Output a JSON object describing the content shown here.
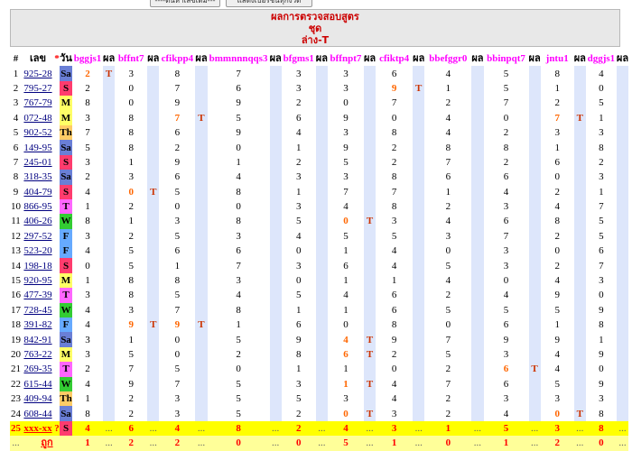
{
  "top_buttons": [
    "----ดันหาเลขเดิม----",
    "แสดงเบอร์ชนทุกงวด"
  ],
  "banner": {
    "line1": "ผลการตรวจสอบสูตร",
    "line2": "ชุด",
    "line3": "ล่าง-T"
  },
  "headers": {
    "num": "#",
    "lek": "เลข",
    "star": "*",
    "wan": "วัน",
    "pon": "ผล",
    "formulas": [
      "bggjs1",
      "bffnt7",
      "cfikpp4",
      "bmmnnnqqs3",
      "bfgms1",
      "bffnpt7",
      "cfiktp4",
      "bbefggr0",
      "bbinpqt7",
      "jntu1",
      "dggjs1"
    ]
  },
  "rows": [
    {
      "i": "1",
      "num": "925-28",
      "day": "Sa",
      "v": [
        {
          "x": "2",
          "h": 1
        },
        {
          "x": "3"
        },
        {
          "x": "8"
        },
        {
          "x": "7"
        },
        {
          "x": "3"
        },
        {
          "x": "3"
        },
        {
          "x": "6"
        },
        {
          "x": "4"
        },
        {
          "x": "5"
        },
        {
          "x": "8"
        },
        {
          "x": "4"
        }
      ],
      "p": [
        "T",
        "",
        "",
        "",
        "",
        "",
        "",
        "",
        "",
        "",
        ""
      ]
    },
    {
      "i": "2",
      "num": "795-27",
      "day": "S",
      "v": [
        {
          "x": "2"
        },
        {
          "x": "0"
        },
        {
          "x": "7"
        },
        {
          "x": "6"
        },
        {
          "x": "3"
        },
        {
          "x": "3"
        },
        {
          "x": "9",
          "h": 1
        },
        {
          "x": "1"
        },
        {
          "x": "5"
        },
        {
          "x": "1"
        },
        {
          "x": "0"
        }
      ],
      "p": [
        "",
        "",
        "",
        "",
        "",
        "",
        "T",
        "",
        "",
        "",
        ""
      ]
    },
    {
      "i": "3",
      "num": "767-79",
      "day": "M",
      "v": [
        {
          "x": "8"
        },
        {
          "x": "0"
        },
        {
          "x": "9"
        },
        {
          "x": "9"
        },
        {
          "x": "2"
        },
        {
          "x": "0"
        },
        {
          "x": "7"
        },
        {
          "x": "2"
        },
        {
          "x": "7"
        },
        {
          "x": "2"
        },
        {
          "x": "5"
        }
      ],
      "p": [
        "",
        "",
        "",
        "",
        "",
        "",
        "",
        "",
        "",
        "",
        ""
      ]
    },
    {
      "i": "4",
      "num": "072-48",
      "day": "M",
      "v": [
        {
          "x": "3"
        },
        {
          "x": "8"
        },
        {
          "x": "7",
          "h": 1
        },
        {
          "x": "5"
        },
        {
          "x": "6"
        },
        {
          "x": "9"
        },
        {
          "x": "0"
        },
        {
          "x": "4"
        },
        {
          "x": "0"
        },
        {
          "x": "7",
          "h": 1
        },
        {
          "x": "1"
        }
      ],
      "p": [
        "",
        "",
        "T",
        "",
        "",
        "",
        "",
        "",
        "",
        "T",
        ""
      ]
    },
    {
      "i": "5",
      "num": "902-52",
      "day": "Th",
      "v": [
        {
          "x": "7"
        },
        {
          "x": "8"
        },
        {
          "x": "6"
        },
        {
          "x": "9"
        },
        {
          "x": "4"
        },
        {
          "x": "3"
        },
        {
          "x": "8"
        },
        {
          "x": "4"
        },
        {
          "x": "2"
        },
        {
          "x": "3"
        },
        {
          "x": "3"
        }
      ],
      "p": [
        "",
        "",
        "",
        "",
        "",
        "",
        "",
        "",
        "",
        "",
        ""
      ]
    },
    {
      "i": "6",
      "num": "149-95",
      "day": "Sa",
      "v": [
        {
          "x": "5"
        },
        {
          "x": "8"
        },
        {
          "x": "2"
        },
        {
          "x": "0"
        },
        {
          "x": "1"
        },
        {
          "x": "9"
        },
        {
          "x": "2"
        },
        {
          "x": "8"
        },
        {
          "x": "8"
        },
        {
          "x": "1"
        },
        {
          "x": "8"
        }
      ],
      "p": [
        "",
        "",
        "",
        "",
        "",
        "",
        "",
        "",
        "",
        "",
        ""
      ]
    },
    {
      "i": "7",
      "num": "245-01",
      "day": "S",
      "v": [
        {
          "x": "3"
        },
        {
          "x": "1"
        },
        {
          "x": "9"
        },
        {
          "x": "1"
        },
        {
          "x": "2"
        },
        {
          "x": "5"
        },
        {
          "x": "2"
        },
        {
          "x": "7"
        },
        {
          "x": "2"
        },
        {
          "x": "6"
        },
        {
          "x": "2"
        }
      ],
      "p": [
        "",
        "",
        "",
        "",
        "",
        "",
        "",
        "",
        "",
        "",
        ""
      ]
    },
    {
      "i": "8",
      "num": "318-35",
      "day": "Sa",
      "v": [
        {
          "x": "2"
        },
        {
          "x": "3"
        },
        {
          "x": "6"
        },
        {
          "x": "4"
        },
        {
          "x": "3"
        },
        {
          "x": "3"
        },
        {
          "x": "8"
        },
        {
          "x": "6"
        },
        {
          "x": "6"
        },
        {
          "x": "0"
        },
        {
          "x": "3"
        }
      ],
      "p": [
        "",
        "",
        "",
        "",
        "",
        "",
        "",
        "",
        "",
        "",
        ""
      ]
    },
    {
      "i": "9",
      "num": "404-79",
      "day": "S",
      "v": [
        {
          "x": "4"
        },
        {
          "x": "0",
          "h": 1
        },
        {
          "x": "5"
        },
        {
          "x": "8"
        },
        {
          "x": "1"
        },
        {
          "x": "7"
        },
        {
          "x": "7"
        },
        {
          "x": "1"
        },
        {
          "x": "4"
        },
        {
          "x": "2"
        },
        {
          "x": "1"
        }
      ],
      "p": [
        "",
        "T",
        "",
        "",
        "",
        "",
        "",
        "",
        "",
        "",
        ""
      ]
    },
    {
      "i": "10",
      "num": "866-95",
      "day": "T",
      "v": [
        {
          "x": "1"
        },
        {
          "x": "2"
        },
        {
          "x": "0"
        },
        {
          "x": "0"
        },
        {
          "x": "3"
        },
        {
          "x": "4"
        },
        {
          "x": "8"
        },
        {
          "x": "2"
        },
        {
          "x": "3"
        },
        {
          "x": "4"
        },
        {
          "x": "7"
        }
      ],
      "p": [
        "",
        "",
        "",
        "",
        "",
        "",
        "",
        "",
        "",
        "",
        ""
      ]
    },
    {
      "i": "11",
      "num": "406-26",
      "day": "W",
      "v": [
        {
          "x": "8"
        },
        {
          "x": "1"
        },
        {
          "x": "3"
        },
        {
          "x": "8"
        },
        {
          "x": "5"
        },
        {
          "x": "0",
          "h": 1
        },
        {
          "x": "3"
        },
        {
          "x": "4"
        },
        {
          "x": "6"
        },
        {
          "x": "8"
        },
        {
          "x": "5"
        }
      ],
      "p": [
        "",
        "",
        "",
        "",
        "",
        "T",
        "",
        "",
        "",
        "",
        ""
      ]
    },
    {
      "i": "12",
      "num": "297-52",
      "day": "F",
      "v": [
        {
          "x": "3"
        },
        {
          "x": "2"
        },
        {
          "x": "5"
        },
        {
          "x": "3"
        },
        {
          "x": "4"
        },
        {
          "x": "5"
        },
        {
          "x": "5"
        },
        {
          "x": "3"
        },
        {
          "x": "7"
        },
        {
          "x": "2"
        },
        {
          "x": "5"
        }
      ],
      "p": [
        "",
        "",
        "",
        "",
        "",
        "",
        "",
        "",
        "",
        "",
        ""
      ]
    },
    {
      "i": "13",
      "num": "523-20",
      "day": "F",
      "v": [
        {
          "x": "4"
        },
        {
          "x": "5"
        },
        {
          "x": "6"
        },
        {
          "x": "6"
        },
        {
          "x": "0"
        },
        {
          "x": "1"
        },
        {
          "x": "4"
        },
        {
          "x": "0"
        },
        {
          "x": "3"
        },
        {
          "x": "0"
        },
        {
          "x": "6"
        }
      ],
      "p": [
        "",
        "",
        "",
        "",
        "",
        "",
        "",
        "",
        "",
        "",
        ""
      ]
    },
    {
      "i": "14",
      "num": "198-18",
      "day": "S",
      "v": [
        {
          "x": "0"
        },
        {
          "x": "5"
        },
        {
          "x": "1"
        },
        {
          "x": "7"
        },
        {
          "x": "3"
        },
        {
          "x": "6"
        },
        {
          "x": "4"
        },
        {
          "x": "5"
        },
        {
          "x": "3"
        },
        {
          "x": "2"
        },
        {
          "x": "7"
        }
      ],
      "p": [
        "",
        "",
        "",
        "",
        "",
        "",
        "",
        "",
        "",
        "",
        ""
      ]
    },
    {
      "i": "15",
      "num": "920-95",
      "day": "M",
      "v": [
        {
          "x": "1"
        },
        {
          "x": "8"
        },
        {
          "x": "8"
        },
        {
          "x": "3"
        },
        {
          "x": "0"
        },
        {
          "x": "1"
        },
        {
          "x": "1"
        },
        {
          "x": "4"
        },
        {
          "x": "0"
        },
        {
          "x": "4"
        },
        {
          "x": "3"
        }
      ],
      "p": [
        "",
        "",
        "",
        "",
        "",
        "",
        "",
        "",
        "",
        "",
        ""
      ]
    },
    {
      "i": "16",
      "num": "477-39",
      "day": "T",
      "v": [
        {
          "x": "3"
        },
        {
          "x": "8"
        },
        {
          "x": "5"
        },
        {
          "x": "4"
        },
        {
          "x": "5"
        },
        {
          "x": "4"
        },
        {
          "x": "6"
        },
        {
          "x": "2"
        },
        {
          "x": "4"
        },
        {
          "x": "9"
        },
        {
          "x": "0"
        }
      ],
      "p": [
        "",
        "",
        "",
        "",
        "",
        "",
        "",
        "",
        "",
        "",
        ""
      ]
    },
    {
      "i": "17",
      "num": "728-45",
      "day": "W",
      "v": [
        {
          "x": "4"
        },
        {
          "x": "3"
        },
        {
          "x": "7"
        },
        {
          "x": "8"
        },
        {
          "x": "1"
        },
        {
          "x": "1"
        },
        {
          "x": "6"
        },
        {
          "x": "5"
        },
        {
          "x": "5"
        },
        {
          "x": "5"
        },
        {
          "x": "9"
        }
      ],
      "p": [
        "",
        "",
        "",
        "",
        "",
        "",
        "",
        "",
        "",
        "",
        ""
      ]
    },
    {
      "i": "18",
      "num": "391-82",
      "day": "F",
      "v": [
        {
          "x": "4"
        },
        {
          "x": "9",
          "h": 1
        },
        {
          "x": "9",
          "h": 1
        },
        {
          "x": "1"
        },
        {
          "x": "6"
        },
        {
          "x": "0"
        },
        {
          "x": "8"
        },
        {
          "x": "0"
        },
        {
          "x": "6"
        },
        {
          "x": "1"
        },
        {
          "x": "8"
        }
      ],
      "p": [
        "",
        "T",
        "T",
        "",
        "",
        "",
        "",
        "",
        "",
        "",
        ""
      ]
    },
    {
      "i": "19",
      "num": "842-91",
      "day": "Sa",
      "v": [
        {
          "x": "3"
        },
        {
          "x": "1"
        },
        {
          "x": "0"
        },
        {
          "x": "5"
        },
        {
          "x": "9"
        },
        {
          "x": "4",
          "h": 1
        },
        {
          "x": "9"
        },
        {
          "x": "7"
        },
        {
          "x": "9"
        },
        {
          "x": "9"
        },
        {
          "x": "1"
        }
      ],
      "p": [
        "",
        "",
        "",
        "",
        "",
        "T",
        "",
        "",
        "",
        "",
        ""
      ]
    },
    {
      "i": "20",
      "num": "763-22",
      "day": "M",
      "v": [
        {
          "x": "3"
        },
        {
          "x": "5"
        },
        {
          "x": "0"
        },
        {
          "x": "2"
        },
        {
          "x": "8"
        },
        {
          "x": "6",
          "h": 1
        },
        {
          "x": "2"
        },
        {
          "x": "5"
        },
        {
          "x": "3"
        },
        {
          "x": "4"
        },
        {
          "x": "9"
        }
      ],
      "p": [
        "",
        "",
        "",
        "",
        "",
        "T",
        "",
        "",
        "",
        "",
        ""
      ]
    },
    {
      "i": "21",
      "num": "269-35",
      "day": "T",
      "v": [
        {
          "x": "2"
        },
        {
          "x": "7"
        },
        {
          "x": "5"
        },
        {
          "x": "0"
        },
        {
          "x": "1"
        },
        {
          "x": "1"
        },
        {
          "x": "0"
        },
        {
          "x": "2"
        },
        {
          "x": "6",
          "h": 1
        },
        {
          "x": "4"
        },
        {
          "x": "0"
        }
      ],
      "p": [
        "",
        "",
        "",
        "",
        "",
        "",
        "",
        "",
        "T",
        "",
        ""
      ]
    },
    {
      "i": "22",
      "num": "615-44",
      "day": "W",
      "v": [
        {
          "x": "4"
        },
        {
          "x": "9"
        },
        {
          "x": "7"
        },
        {
          "x": "5"
        },
        {
          "x": "3"
        },
        {
          "x": "1",
          "h": 1
        },
        {
          "x": "4"
        },
        {
          "x": "7"
        },
        {
          "x": "6"
        },
        {
          "x": "5"
        },
        {
          "x": "9"
        }
      ],
      "p": [
        "",
        "",
        "",
        "",
        "",
        "T",
        "",
        "",
        "",
        "",
        ""
      ]
    },
    {
      "i": "23",
      "num": "409-94",
      "day": "Th",
      "v": [
        {
          "x": "1"
        },
        {
          "x": "2"
        },
        {
          "x": "3"
        },
        {
          "x": "5"
        },
        {
          "x": "5"
        },
        {
          "x": "3"
        },
        {
          "x": "4"
        },
        {
          "x": "2"
        },
        {
          "x": "3"
        },
        {
          "x": "3"
        },
        {
          "x": "3"
        }
      ],
      "p": [
        "",
        "",
        "",
        "",
        "",
        "",
        "",
        "",
        "",
        "",
        ""
      ]
    },
    {
      "i": "24",
      "num": "608-44",
      "day": "Sa",
      "v": [
        {
          "x": "8"
        },
        {
          "x": "2"
        },
        {
          "x": "3"
        },
        {
          "x": "5"
        },
        {
          "x": "2"
        },
        {
          "x": "0",
          "h": 1
        },
        {
          "x": "3"
        },
        {
          "x": "2"
        },
        {
          "x": "4"
        },
        {
          "x": "0",
          "h": 1
        },
        {
          "x": "8"
        }
      ],
      "p": [
        "",
        "",
        "",
        "",
        "",
        "T",
        "",
        "",
        "",
        "T",
        ""
      ]
    }
  ],
  "prediction_row": {
    "i": "25",
    "num": "xxx-xx",
    "star": "?",
    "day": "S",
    "v": [
      "4",
      "6",
      "4",
      "8",
      "2",
      "4",
      "3",
      "1",
      "5",
      "3",
      "8"
    ],
    "dots": "..."
  },
  "score_row": {
    "i": "...",
    "label": "ถูก",
    "dots": "...",
    "v": [
      "1",
      "2",
      "2",
      "0",
      "0",
      "5",
      "1",
      "0",
      "1",
      "2",
      "0"
    ]
  }
}
